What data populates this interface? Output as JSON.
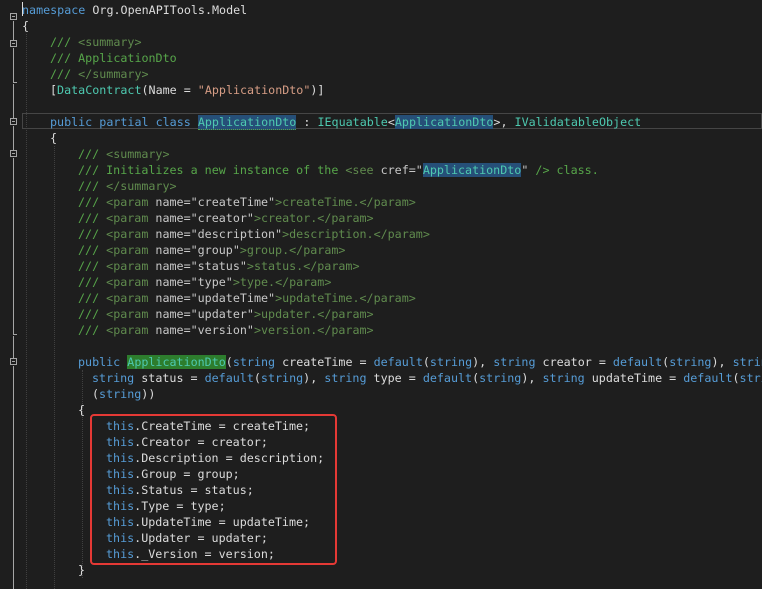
{
  "colors": {
    "background": "#1e1e1e",
    "plain": "#dcdcdc",
    "keyword": "#569cd6",
    "type": "#4ec9b0",
    "string": "#d69d85",
    "comment": "#57a64a",
    "xml_tag": "#608b4e",
    "xml_attr": "#c8c8c8",
    "highlight_bg": "#264f78",
    "ref_highlight_bg": "#2d7d2d",
    "red_box": "#e53935"
  },
  "editor": {
    "lines": [
      {
        "indent": 0,
        "tokens": [
          [
            "namespace",
            "keyword"
          ],
          [
            " Org.OpenAPITools.Model",
            "plain"
          ]
        ]
      },
      {
        "indent": 0,
        "tokens": [
          [
            "{",
            "plain"
          ]
        ]
      },
      {
        "indent": 1,
        "tokens": [
          [
            "/// ",
            "comment"
          ],
          [
            "<summary>",
            "xml_tag"
          ]
        ]
      },
      {
        "indent": 1,
        "tokens": [
          [
            "/// ApplicationDto",
            "comment"
          ]
        ]
      },
      {
        "indent": 1,
        "tokens": [
          [
            "/// ",
            "comment"
          ],
          [
            "</summary>",
            "xml_tag"
          ]
        ]
      },
      {
        "indent": 1,
        "tokens": [
          [
            "[",
            "plain"
          ],
          [
            "DataContract",
            "type"
          ],
          [
            "(Name = ",
            "plain"
          ],
          [
            "\"ApplicationDto\"",
            "string"
          ],
          [
            ")]",
            "plain"
          ]
        ]
      },
      {
        "indent": 1,
        "tokens": []
      },
      {
        "indent": 1,
        "tokens": [
          [
            "public",
            "keyword"
          ],
          [
            " ",
            "plain"
          ],
          [
            "partial",
            "keyword"
          ],
          [
            " ",
            "plain"
          ],
          [
            "class",
            "keyword"
          ],
          [
            " ",
            "plain"
          ],
          [
            "ApplicationDto",
            "type_hl"
          ],
          [
            " : ",
            "plain"
          ],
          [
            "IEquatable",
            "type"
          ],
          [
            "<",
            "plain"
          ],
          [
            "ApplicationDto",
            "type_hl"
          ],
          [
            ">, ",
            "plain"
          ],
          [
            "IValidatableObject",
            "type"
          ]
        ]
      },
      {
        "indent": 1,
        "tokens": [
          [
            "{",
            "plain"
          ]
        ]
      },
      {
        "indent": 2,
        "tokens": [
          [
            "/// ",
            "comment"
          ],
          [
            "<summary>",
            "xml_tag"
          ]
        ]
      },
      {
        "indent": 2,
        "tokens": [
          [
            "/// Initializes a new instance of the ",
            "comment"
          ],
          [
            "<see ",
            "xml_tag"
          ],
          [
            "cref=",
            "xml_attr"
          ],
          [
            "\"",
            "xml_attr"
          ],
          [
            "ApplicationDto",
            "type_hl"
          ],
          [
            "\"",
            "xml_attr"
          ],
          [
            " /> class.",
            "comment"
          ]
        ]
      },
      {
        "indent": 2,
        "tokens": [
          [
            "/// ",
            "comment"
          ],
          [
            "</summary>",
            "xml_tag"
          ]
        ]
      },
      {
        "indent": 2,
        "tokens": [
          [
            "/// ",
            "comment"
          ],
          [
            "<param ",
            "xml_tag"
          ],
          [
            "name=",
            "xml_attr"
          ],
          [
            "\"createTime\"",
            "xml_attr"
          ],
          [
            ">createTime.</param>",
            "xml_tag"
          ]
        ]
      },
      {
        "indent": 2,
        "tokens": [
          [
            "/// ",
            "comment"
          ],
          [
            "<param ",
            "xml_tag"
          ],
          [
            "name=",
            "xml_attr"
          ],
          [
            "\"creator\"",
            "xml_attr"
          ],
          [
            ">creator.</param>",
            "xml_tag"
          ]
        ]
      },
      {
        "indent": 2,
        "tokens": [
          [
            "/// ",
            "comment"
          ],
          [
            "<param ",
            "xml_tag"
          ],
          [
            "name=",
            "xml_attr"
          ],
          [
            "\"description\"",
            "xml_attr"
          ],
          [
            ">description.</param>",
            "xml_tag"
          ]
        ]
      },
      {
        "indent": 2,
        "tokens": [
          [
            "/// ",
            "comment"
          ],
          [
            "<param ",
            "xml_tag"
          ],
          [
            "name=",
            "xml_attr"
          ],
          [
            "\"group\"",
            "xml_attr"
          ],
          [
            ">group.</param>",
            "xml_tag"
          ]
        ]
      },
      {
        "indent": 2,
        "tokens": [
          [
            "/// ",
            "comment"
          ],
          [
            "<param ",
            "xml_tag"
          ],
          [
            "name=",
            "xml_attr"
          ],
          [
            "\"status\"",
            "xml_attr"
          ],
          [
            ">status.</param>",
            "xml_tag"
          ]
        ]
      },
      {
        "indent": 2,
        "tokens": [
          [
            "/// ",
            "comment"
          ],
          [
            "<param ",
            "xml_tag"
          ],
          [
            "name=",
            "xml_attr"
          ],
          [
            "\"type\"",
            "xml_attr"
          ],
          [
            ">type.</param>",
            "xml_tag"
          ]
        ]
      },
      {
        "indent": 2,
        "tokens": [
          [
            "/// ",
            "comment"
          ],
          [
            "<param ",
            "xml_tag"
          ],
          [
            "name=",
            "xml_attr"
          ],
          [
            "\"updateTime\"",
            "xml_attr"
          ],
          [
            ">updateTime.</param>",
            "xml_tag"
          ]
        ]
      },
      {
        "indent": 2,
        "tokens": [
          [
            "/// ",
            "comment"
          ],
          [
            "<param ",
            "xml_tag"
          ],
          [
            "name=",
            "xml_attr"
          ],
          [
            "\"updater\"",
            "xml_attr"
          ],
          [
            ">updater.</param>",
            "xml_tag"
          ]
        ]
      },
      {
        "indent": 2,
        "tokens": [
          [
            "/// ",
            "comment"
          ],
          [
            "<param ",
            "xml_tag"
          ],
          [
            "name=",
            "xml_attr"
          ],
          [
            "\"version\"",
            "xml_attr"
          ],
          [
            ">version.</param>",
            "xml_tag"
          ]
        ]
      },
      {
        "indent": 2,
        "tokens": []
      },
      {
        "indent": 2,
        "tokens": [
          [
            "public",
            "keyword"
          ],
          [
            " ",
            "plain"
          ],
          [
            "ApplicationDto",
            "type_ref"
          ],
          [
            "(",
            "plain"
          ],
          [
            "string",
            "keyword"
          ],
          [
            " createTime = ",
            "plain"
          ],
          [
            "default",
            "keyword"
          ],
          [
            "(",
            "plain"
          ],
          [
            "string",
            "keyword"
          ],
          [
            "), ",
            "plain"
          ],
          [
            "string",
            "keyword"
          ],
          [
            " creator = ",
            "plain"
          ],
          [
            "default",
            "keyword"
          ],
          [
            "(",
            "plain"
          ],
          [
            "string",
            "keyword"
          ],
          [
            "), ",
            "plain"
          ],
          [
            "string",
            "keyword"
          ]
        ]
      },
      {
        "indent": 2,
        "extra": 14,
        "tokens": [
          [
            "string",
            "keyword"
          ],
          [
            " status = ",
            "plain"
          ],
          [
            "default",
            "keyword"
          ],
          [
            "(",
            "plain"
          ],
          [
            "string",
            "keyword"
          ],
          [
            "), ",
            "plain"
          ],
          [
            "string",
            "keyword"
          ],
          [
            " type = ",
            "plain"
          ],
          [
            "default",
            "keyword"
          ],
          [
            "(",
            "plain"
          ],
          [
            "string",
            "keyword"
          ],
          [
            "), ",
            "plain"
          ],
          [
            "string",
            "keyword"
          ],
          [
            " updateTime = ",
            "plain"
          ],
          [
            "default",
            "keyword"
          ],
          [
            "(",
            "plain"
          ],
          [
            "string",
            "keyword"
          ]
        ]
      },
      {
        "indent": 2,
        "extra": 14,
        "tokens": [
          [
            "(",
            "plain"
          ],
          [
            "string",
            "keyword"
          ],
          [
            "))",
            "plain"
          ]
        ]
      },
      {
        "indent": 2,
        "tokens": [
          [
            "{",
            "plain"
          ]
        ]
      },
      {
        "indent": 3,
        "tokens": [
          [
            "this",
            "keyword"
          ],
          [
            ".CreateTime = createTime;",
            "plain"
          ]
        ]
      },
      {
        "indent": 3,
        "tokens": [
          [
            "this",
            "keyword"
          ],
          [
            ".Creator = creator;",
            "plain"
          ]
        ]
      },
      {
        "indent": 3,
        "tokens": [
          [
            "this",
            "keyword"
          ],
          [
            ".Description = description;",
            "plain"
          ]
        ]
      },
      {
        "indent": 3,
        "tokens": [
          [
            "this",
            "keyword"
          ],
          [
            ".Group = group;",
            "plain"
          ]
        ]
      },
      {
        "indent": 3,
        "tokens": [
          [
            "this",
            "keyword"
          ],
          [
            ".Status = status;",
            "plain"
          ]
        ]
      },
      {
        "indent": 3,
        "tokens": [
          [
            "this",
            "keyword"
          ],
          [
            ".Type = type;",
            "plain"
          ]
        ]
      },
      {
        "indent": 3,
        "tokens": [
          [
            "this",
            "keyword"
          ],
          [
            ".UpdateTime = updateTime;",
            "plain"
          ]
        ]
      },
      {
        "indent": 3,
        "tokens": [
          [
            "this",
            "keyword"
          ],
          [
            ".Updater = updater;",
            "plain"
          ]
        ]
      },
      {
        "indent": 3,
        "tokens": [
          [
            "this",
            "keyword"
          ],
          [
            "._Version = version;",
            "plain"
          ]
        ]
      },
      {
        "indent": 2,
        "tokens": [
          [
            "}",
            "plain"
          ]
        ]
      }
    ]
  }
}
